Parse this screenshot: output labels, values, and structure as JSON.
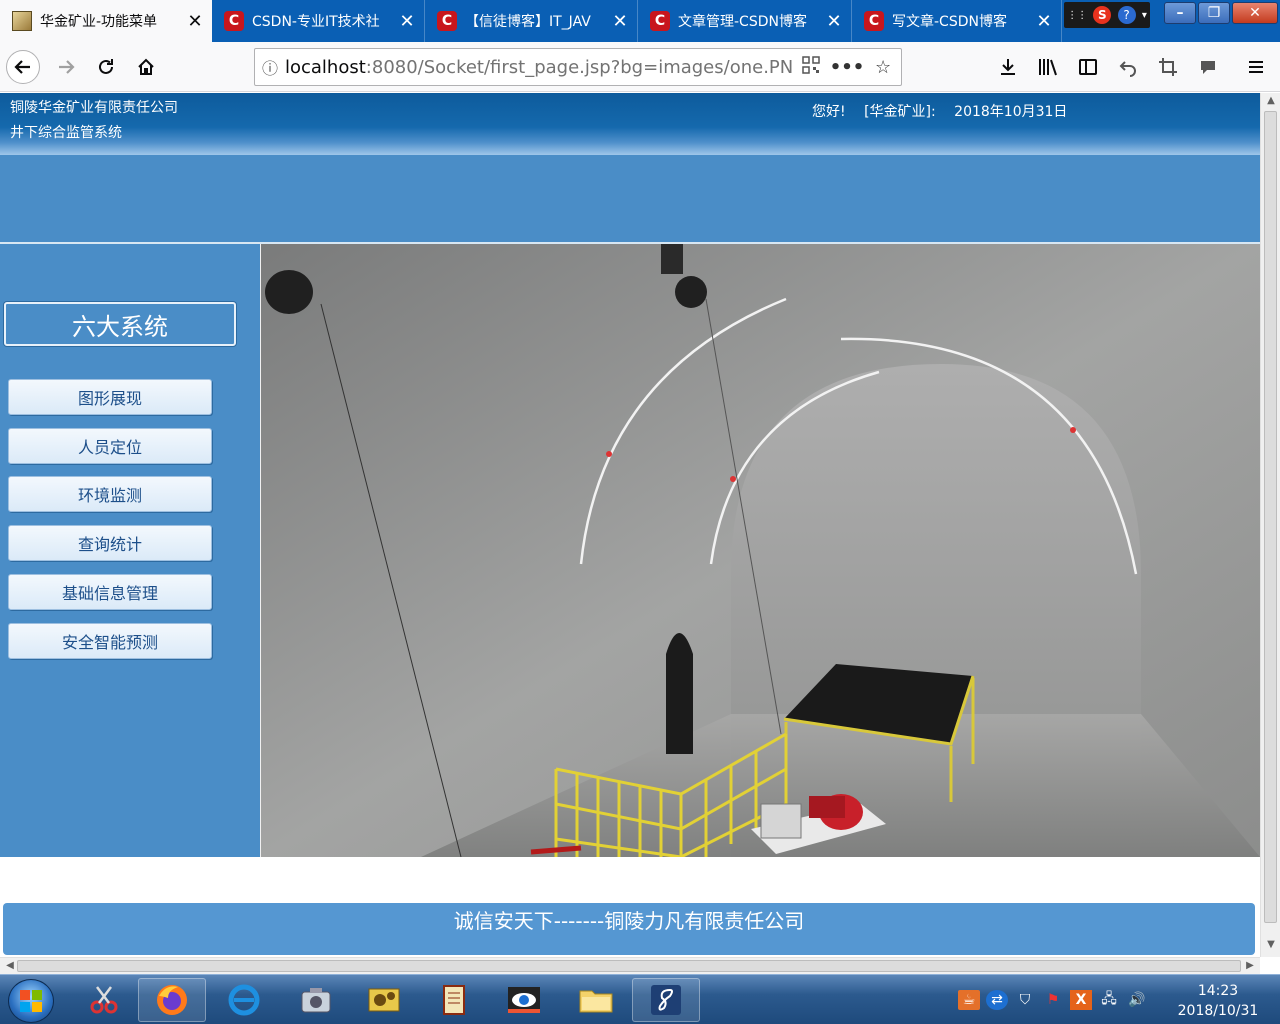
{
  "browser": {
    "tabs": [
      {
        "label": "华金矿业-功能菜单",
        "icon": "ore-icon",
        "active": true
      },
      {
        "label": "CSDN-专业IT技术社",
        "icon": "csdn-icon",
        "active": false
      },
      {
        "label": "【信徒博客】IT_JAV",
        "icon": "csdn-icon",
        "active": false
      },
      {
        "label": "文章管理-CSDN博客",
        "icon": "csdn-icon",
        "active": false
      },
      {
        "label": "写文章-CSDN博客",
        "icon": "csdn-icon",
        "active": false
      }
    ],
    "csdn_glyph": "C",
    "url_host": "localhost",
    "url_rest": ":8080/Socket/first_page.jsp?bg=images/one.PN",
    "accent": "#0a5fb4"
  },
  "page": {
    "company": "铜陵华金矿业有限责任公司",
    "system_name": "井下综合监管系统",
    "greeting": "您好!",
    "org_tag": "[华金矿业]:",
    "date": "2018年10月31日",
    "panel_title": "六大系统",
    "menu": [
      {
        "label": "图形展现"
      },
      {
        "label": "人员定位"
      },
      {
        "label": "环境监测"
      },
      {
        "label": "查询统计"
      },
      {
        "label": "基础信息管理"
      },
      {
        "label": "安全智能预测"
      }
    ],
    "footer": "诚信安天下-------铜陵力凡有限责任公司",
    "header_color": "#0d5b9c",
    "panel_color": "#4a8dc7"
  },
  "taskbar": {
    "time": "14:23",
    "date": "2018/10/31"
  }
}
